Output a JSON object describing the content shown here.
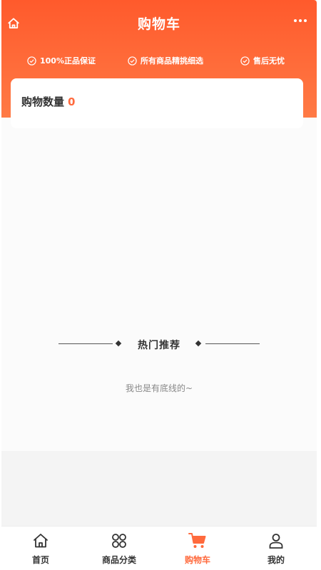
{
  "colors": {
    "accent": "#ff5a2c",
    "accent_light": "#ff7a45",
    "count": "#ff6a3d"
  },
  "header": {
    "title": "购物车",
    "home_icon": "home-icon",
    "more_icon": "more-icon",
    "guarantees": [
      {
        "icon": "check-circle-icon",
        "label": "100%正品保证"
      },
      {
        "icon": "check-circle-icon",
        "label": "所有商品精挑细选"
      },
      {
        "icon": "check-circle-icon",
        "label": "售后无忧"
      }
    ]
  },
  "cart": {
    "count_label": "购物数量",
    "count_value": "0"
  },
  "recommend": {
    "title": "热门推荐",
    "bottom_note": "我也是有底线的~"
  },
  "tabbar": {
    "active": "cart",
    "items": [
      {
        "id": "home",
        "icon": "home-icon",
        "label": "首页"
      },
      {
        "id": "category",
        "icon": "category-icon",
        "label": "商品分类"
      },
      {
        "id": "cart",
        "icon": "cart-icon",
        "label": "购物车"
      },
      {
        "id": "mine",
        "icon": "user-icon",
        "label": "我的"
      }
    ]
  }
}
